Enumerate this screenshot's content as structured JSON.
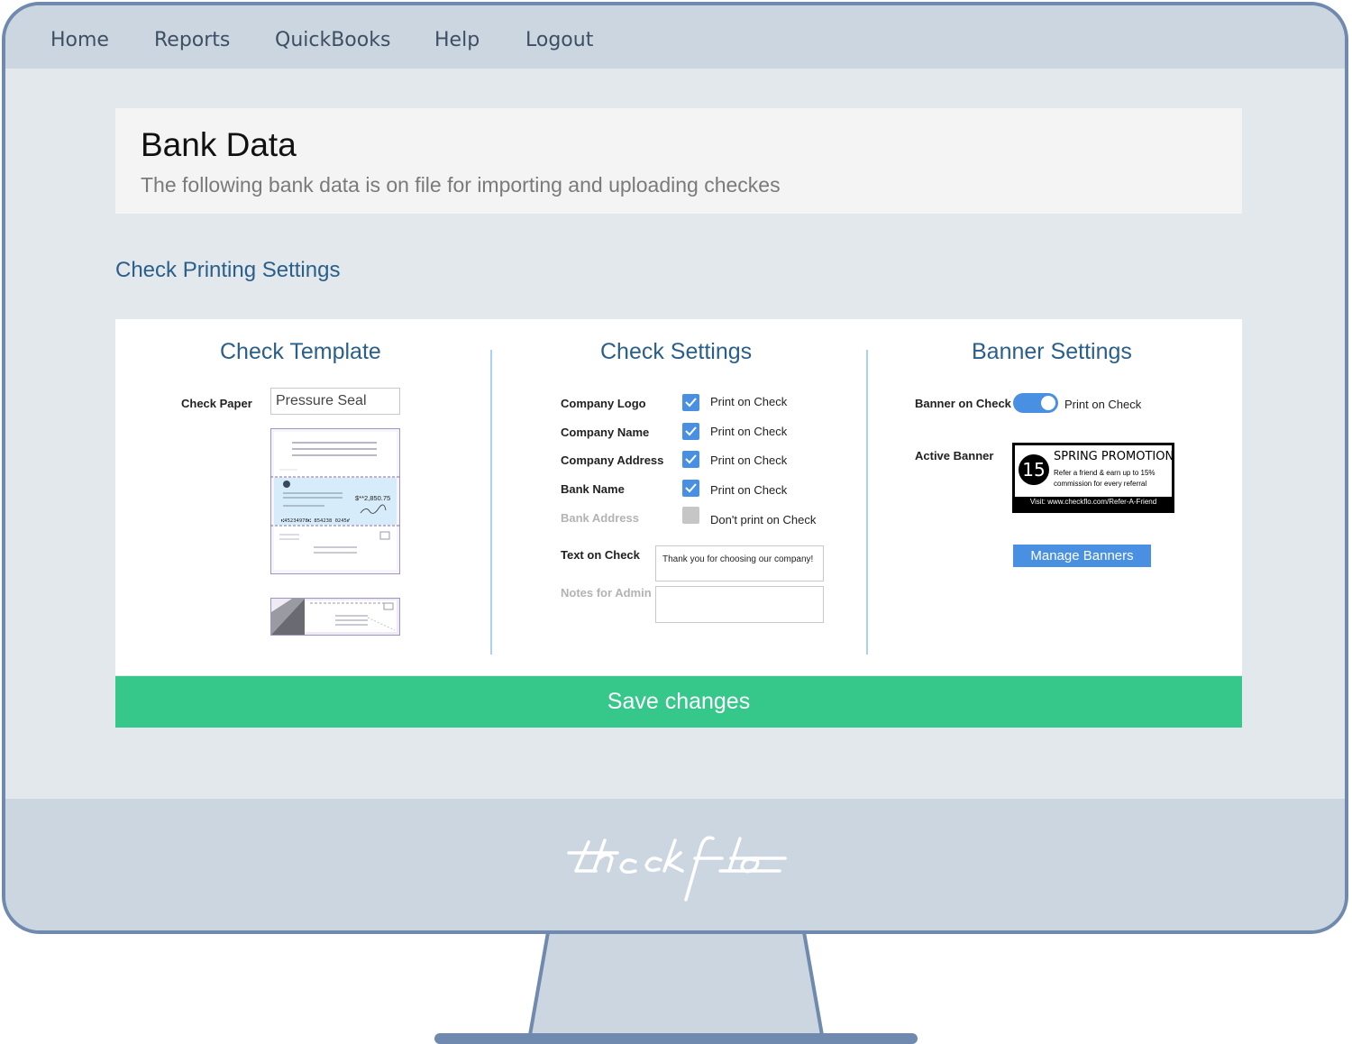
{
  "nav": {
    "items": [
      {
        "label": "Home"
      },
      {
        "label": "Reports"
      },
      {
        "label": "QuickBooks"
      },
      {
        "label": "Help"
      },
      {
        "label": "Logout"
      }
    ]
  },
  "header": {
    "title": "Bank Data",
    "subtitle": "The following bank data is on file for importing and uploading checkes"
  },
  "section": {
    "title": "Check Printing Settings"
  },
  "check_template": {
    "title": "Check Template",
    "paper_label": "Check Paper",
    "paper_value": "Pressure Seal",
    "preview_amount": "$**2,850.75",
    "preview_micr": "⑆45234978⑆ 854238 0245⑈"
  },
  "check_settings": {
    "title": "Check Settings",
    "rows": [
      {
        "label": "Company Logo",
        "option": "Print on Check",
        "checked": true
      },
      {
        "label": "Company Name",
        "option": "Print on Check",
        "checked": true
      },
      {
        "label": "Company Address",
        "option": "Print on Check",
        "checked": true
      },
      {
        "label": "Bank Name",
        "option": "Print on Check",
        "checked": true
      },
      {
        "label": "Bank Address",
        "option": "Don't print on Check",
        "checked": false
      }
    ],
    "text_on_check_label": "Text on Check",
    "text_on_check_value": "Thank you for choosing our company!",
    "notes_label": "Notes for Admin",
    "notes_value": ""
  },
  "banner_settings": {
    "title": "Banner Settings",
    "banner_on_check_label": "Banner on Check",
    "banner_on_check_option": "Print on Check",
    "toggle_on": true,
    "active_banner_label": "Active Banner",
    "banner": {
      "number": "15",
      "title": "SPRING PROMOTION",
      "body": "Refer a friend & earn up to 15% commission for every referral",
      "footer": "Visit: www.checkflo.com/Refer-A-Friend"
    },
    "manage_label": "Manage Banners"
  },
  "save_label": "Save changes",
  "colors": {
    "accent_blue": "#4a90e2",
    "heading_blue": "#2a5f8a",
    "save_green": "#36c78a",
    "frame": "#6f8aae"
  }
}
